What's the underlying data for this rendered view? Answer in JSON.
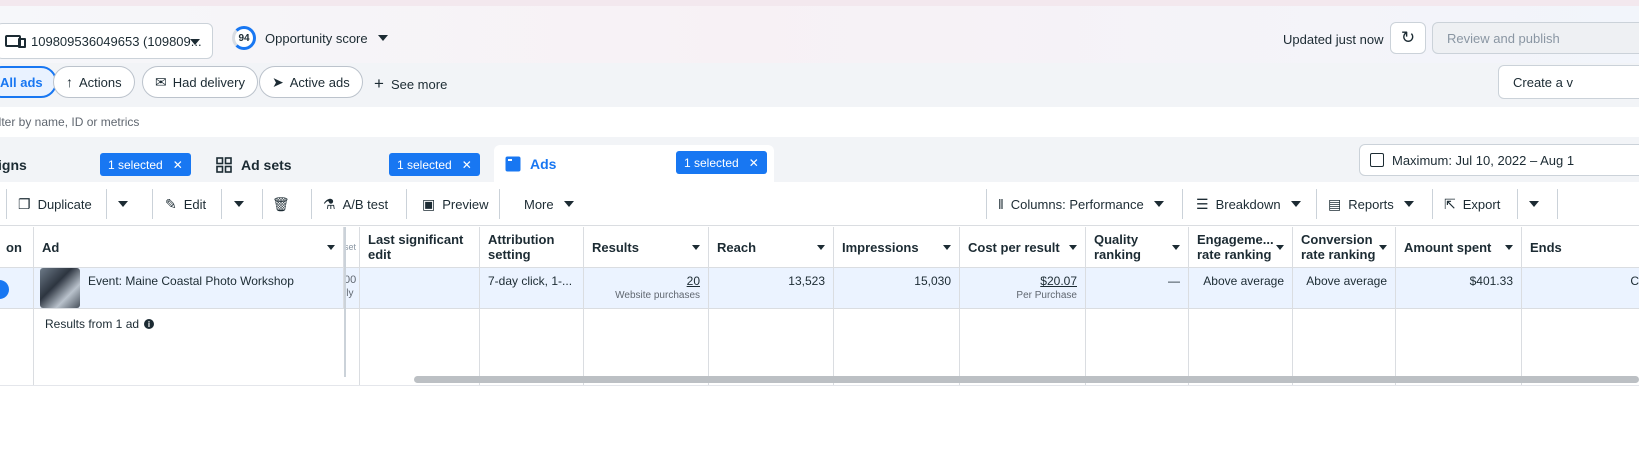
{
  "header": {
    "account": "109809536049653 (109809...",
    "score_value": "94",
    "score_label": "Opportunity score",
    "updated": "Updated just now",
    "review_publish": "Review and publish"
  },
  "filters": {
    "chips": [
      "All ads",
      "Actions",
      "Had delivery",
      "Active ads"
    ],
    "see_more": "See more",
    "create": "Create a v",
    "search_placeholder": "ilter by name, ID or metrics"
  },
  "tabs": {
    "campaigns": "igns",
    "adsets": "Ad sets",
    "ads": "Ads",
    "selected": "1 selected",
    "date_range": "Maximum: Jul 10, 2022 – Aug 1"
  },
  "toolbar": {
    "duplicate": "Duplicate",
    "edit": "Edit",
    "ab_test": "A/B test",
    "preview": "Preview",
    "more": "More",
    "columns": "Columns: Performance",
    "breakdown": "Breakdown",
    "reports": "Reports",
    "export": "Export"
  },
  "table": {
    "headers": {
      "off_on": "on",
      "ad": "Ad",
      "last_edit": "Last significant edit",
      "attribution": "Attribution setting",
      "results": "Results",
      "reach": "Reach",
      "impressions": "Impressions",
      "cost": "Cost per result",
      "quality": "Quality ranking",
      "engagement": "Engageme... rate ranking",
      "conversion": "Conversion rate ranking",
      "amount": "Amount spent",
      "ends": "Ends"
    },
    "row": {
      "ad_name": "Event: Maine Coastal Photo Workshop",
      "clipped_value": "00",
      "clipped_sub": "ily",
      "clipped_header": "set",
      "attribution": "7-day click, 1-...",
      "results": "20",
      "results_sub": "Website purchases",
      "reach": "13,523",
      "impressions": "15,030",
      "cost": "$20.07",
      "cost_sub": "Per Purchase",
      "quality": "—",
      "engagement": "Above average",
      "conversion": "Above average",
      "amount": "$401.33",
      "ends": "C"
    },
    "results_note": "Results from 1 ad"
  },
  "colors": {
    "accent": "#1877f2",
    "row_highlight": "#ebf3ff"
  },
  "icons": [
    "ad-account-icon",
    "refresh-icon",
    "actions-icon",
    "envelope-icon",
    "send-icon",
    "plus-icon",
    "grid-icon",
    "ads-icon",
    "close-icon",
    "calendar-icon",
    "duplicate-icon",
    "pencil-icon",
    "trash-icon",
    "flask-icon",
    "preview-icon",
    "columns-icon",
    "breakdown-icon",
    "reports-icon",
    "export-icon",
    "info-icon"
  ]
}
